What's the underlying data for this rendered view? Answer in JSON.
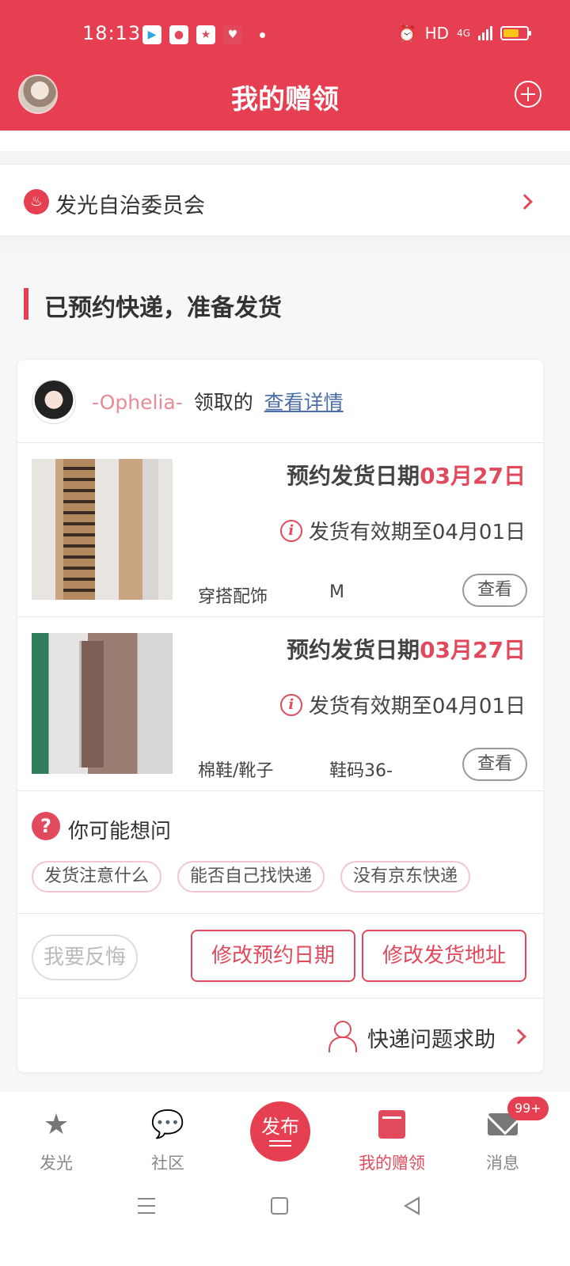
{
  "status_bar": {
    "time": "18:13",
    "hd": "HD",
    "network": "4G",
    "battery_level": 0.58,
    "app_icons": [
      "video-app-icon",
      "map-app-icon",
      "star-app-icon",
      "heart-app-icon"
    ]
  },
  "header": {
    "title": "我的赠领",
    "add_icon": "plus-circle-icon"
  },
  "community": {
    "label": "发光自治委员会"
  },
  "section": {
    "title": "已预约快递，准备发货"
  },
  "order": {
    "claimer_name": "-Ophelia-",
    "claimed_text": "领取的",
    "details_link": "查看详情",
    "items": [
      {
        "date_label": "预约发货日期",
        "date_value": "03月27日",
        "validity": "发货有效期至04月01日",
        "category": "穿搭配饰",
        "size": "M",
        "view_label": "查看"
      },
      {
        "date_label": "预约发货日期",
        "date_value": "03月27日",
        "validity": "发货有效期至04月01日",
        "category": "棉鞋/靴子",
        "size": "鞋码36-",
        "view_label": "查看"
      }
    ]
  },
  "faq": {
    "title": "你可能想问",
    "tags": [
      "发货注意什么",
      "能否自己找快递",
      "没有京东快递"
    ]
  },
  "actions": {
    "regret": "我要反悔",
    "modify_date": "修改预约日期",
    "modify_address": "修改发货地址"
  },
  "help": {
    "label": "快递问题求助"
  },
  "tabbar": {
    "tabs": [
      {
        "label": "发光",
        "icon": "star-icon"
      },
      {
        "label": "社区",
        "icon": "chat-bubble-icon"
      },
      {
        "label": "发布",
        "icon": "publish-icon"
      },
      {
        "label": "我的赠领",
        "icon": "gift-box-icon"
      },
      {
        "label": "消息",
        "icon": "mail-icon"
      }
    ],
    "badge": "99+",
    "active_tab": "我的赠领"
  },
  "colors": {
    "brand": "#e63f52",
    "accent_text": "#e04a5c",
    "link": "#4a6ea8"
  }
}
